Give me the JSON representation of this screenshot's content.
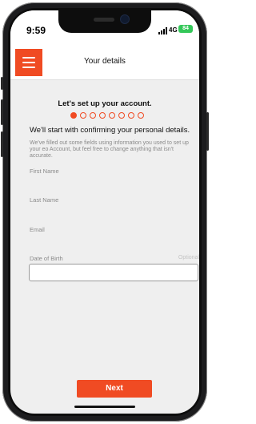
{
  "status_bar": {
    "time": "9:59",
    "network": "4G",
    "battery": "84"
  },
  "header": {
    "title": "Your details",
    "menu_icon": "hamburger-menu-icon"
  },
  "content": {
    "section_title": "Let's set up your account.",
    "progress": {
      "total_steps": 8,
      "current_step": 1
    },
    "intro": "We'll start with confirming your personal details.",
    "description": "We've filled out some fields using information you used to set up your eo Account, but feel free to change anything that isn't accurate."
  },
  "form": {
    "first_name_label": "First Name",
    "last_name_label": "Last Name",
    "email_label": "Email",
    "dob_label": "Date of Birth",
    "dob_optional": "Optional",
    "dob_value": ""
  },
  "footer": {
    "next_label": "Next"
  },
  "colors": {
    "accent": "#f04b23",
    "background": "#efefef",
    "battery": "#34c759"
  }
}
